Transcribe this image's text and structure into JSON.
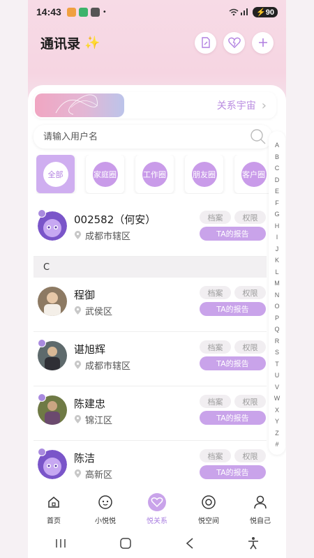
{
  "status": {
    "time": "14:43",
    "battery": "90"
  },
  "header": {
    "title": "通讯录",
    "sparkle": "✨"
  },
  "banner": {
    "label": "关系宇宙",
    "chevron": "›"
  },
  "search": {
    "placeholder": "请输入用户名"
  },
  "categories": [
    {
      "label": "全部",
      "active": true
    },
    {
      "label": "家庭圈"
    },
    {
      "label": "工作圈"
    },
    {
      "label": "朋友圈"
    },
    {
      "label": "客户圈"
    }
  ],
  "contacts_top": [
    {
      "name": "002582（何安）",
      "location": "成都市辖区",
      "tag1": "档案",
      "tag2": "权限",
      "report": "TA的报告",
      "avatar": "cartoon"
    }
  ],
  "section_c": {
    "letter": "C"
  },
  "contacts_c": [
    {
      "name": "程御",
      "location": "武侯区",
      "tag1": "档案",
      "tag2": "权限",
      "report": "TA的报告",
      "avatar": "photo1"
    },
    {
      "name": "谌旭辉",
      "location": "成都市辖区",
      "tag1": "档案",
      "tag2": "权限",
      "report": "TA的报告",
      "avatar": "photo2"
    },
    {
      "name": "陈建忠",
      "location": "锦江区",
      "tag1": "档案",
      "tag2": "权限",
      "report": "TA的报告",
      "avatar": "photo3"
    },
    {
      "name": "陈洁",
      "location": "高新区",
      "tag1": "档案",
      "tag2": "权限",
      "report": "TA的报告",
      "avatar": "cartoon"
    }
  ],
  "alphabet": [
    "A",
    "B",
    "C",
    "D",
    "E",
    "F",
    "G",
    "H",
    "I",
    "J",
    "K",
    "L",
    "M",
    "N",
    "O",
    "P",
    "Q",
    "R",
    "S",
    "T",
    "U",
    "V",
    "W",
    "X",
    "Y",
    "Z",
    "#"
  ],
  "tabs": [
    {
      "label": "首页",
      "icon": "home-icon"
    },
    {
      "label": "小悦悦",
      "icon": "smile-icon"
    },
    {
      "label": "悦关系",
      "icon": "heart-diamond-icon",
      "active": true
    },
    {
      "label": "悦空间",
      "icon": "target-icon"
    },
    {
      "label": "悦自己",
      "icon": "person-icon"
    }
  ],
  "colors": {
    "accent": "#c9a3ea",
    "accent_text": "#a97ee0",
    "hero": "#f6d5e2"
  }
}
